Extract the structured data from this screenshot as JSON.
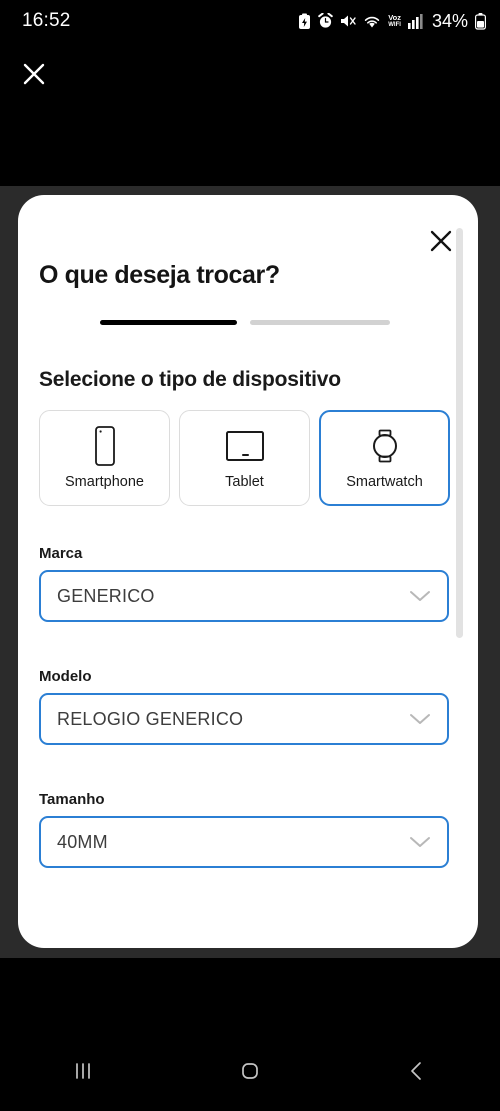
{
  "statusbar": {
    "clock": "16:52",
    "battery_percent": "34%",
    "vowifi_line1": "Voz",
    "vowifi_line2": "WIFI",
    "icons": [
      "battery-saver-icon",
      "alarm-icon",
      "mute-icon",
      "wifi-icon",
      "vowifi-icon",
      "signal-bars-icon",
      "battery-icon"
    ]
  },
  "app": {
    "close_label": "×"
  },
  "sheet": {
    "title": "O que deseja trocar?",
    "close_label": "×",
    "steps": [
      {
        "state": "active"
      },
      {
        "state": "inactive"
      }
    ],
    "section_heading": "Selecione o tipo de dispositivo",
    "device_types": [
      {
        "label": "Smartphone",
        "icon": "smartphone-icon",
        "selected": false
      },
      {
        "label": "Tablet",
        "icon": "tablet-icon",
        "selected": false
      },
      {
        "label": "Smartwatch",
        "icon": "smartwatch-icon",
        "selected": true
      }
    ],
    "fields": [
      {
        "label": "Marca",
        "value": "GENERICO"
      },
      {
        "label": "Modelo",
        "value": "RELOGIO GENERICO"
      },
      {
        "label": "Tamanho",
        "value": "40MM"
      }
    ]
  },
  "navbar": {
    "recents_label": "recents-icon",
    "home_label": "home-icon",
    "back_label": "back-icon"
  },
  "colors": {
    "accent_blue": "#2b7fd4",
    "scrim": "#2b2b2b",
    "step_active": "#000000",
    "step_inactive": "#d2d2d2",
    "card_border": "#dcdcdc"
  }
}
